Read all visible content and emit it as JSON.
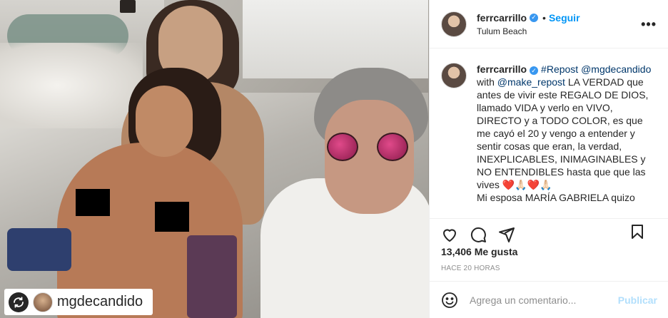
{
  "header": {
    "username": "ferrcarrillo",
    "follow_label": "Seguir",
    "dot": "•",
    "location": "Tulum Beach",
    "more": "•••"
  },
  "caption": {
    "username": "ferrcarrillo",
    "hashtag": "#Repost",
    "mention_1": "@mgdecandido",
    "with_text": "with",
    "mention_2": "@make_repost",
    "body": "LA VERDAD que antes de vivir este REGALO DE DIOS, llamado VIDA y verlo en VIVO, DIRECTO y a TODO COLOR, es que me cayó el 20 y vengo a entender y sentir cosas que eran, la verdad, INEXPLICABLES, INIMAGINABLES y NO ENTENDIBLES hasta que que las vives ❤️🙏🏻❤️🙏🏻",
    "body_2": "Mi esposa MARÍA GABRIELA quizo"
  },
  "actions": {
    "like": "heart-icon",
    "comment": "comment-icon",
    "share": "share-icon",
    "save": "bookmark-icon"
  },
  "likes": "13,406 Me gusta",
  "time": "HACE 20 HORAS",
  "comment_box": {
    "placeholder": "Agrega un comentario...",
    "publish_label": "Publicar"
  },
  "photo": {
    "tag_username": "mgdecandido"
  },
  "colors": {
    "link": "#00376b",
    "follow": "#0095f6",
    "publish_disabled": "#b2dffc",
    "muted": "#8e8e8e"
  }
}
